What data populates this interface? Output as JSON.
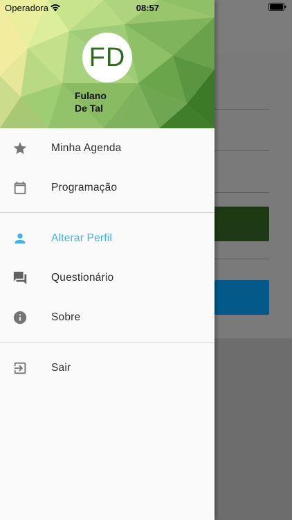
{
  "status_bar": {
    "carrier": "Operadora",
    "time": "08:57"
  },
  "drawer": {
    "avatar_initials": "FD",
    "user_name_line1": "Fulano",
    "user_name_line2": "De Tal",
    "active_color": "#3fb3e6",
    "menu": [
      {
        "label": "Minha Agenda",
        "icon": "star-icon"
      },
      {
        "label": "Programação",
        "icon": "calendar-icon"
      },
      {
        "label": "Alterar Perfil",
        "icon": "person-icon",
        "active": true
      },
      {
        "label": "Questionário",
        "icon": "forum-icon"
      },
      {
        "label": "Sobre",
        "icon": "info-icon"
      },
      {
        "label": "Sair",
        "icon": "exit-icon"
      }
    ]
  }
}
